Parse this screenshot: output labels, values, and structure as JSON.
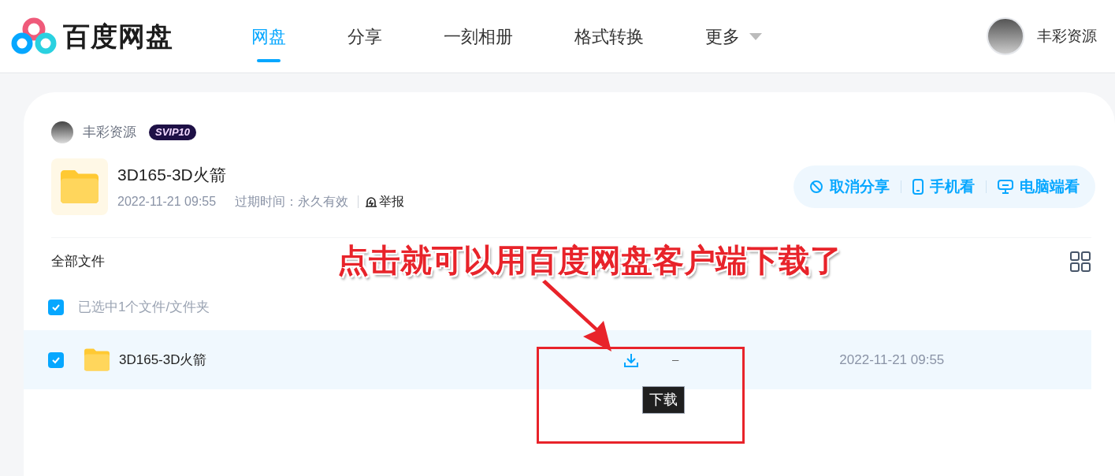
{
  "header": {
    "logo_text": "百度网盘",
    "nav": [
      {
        "label": "网盘",
        "selected": true,
        "dropdown": false
      },
      {
        "label": "分享",
        "selected": false,
        "dropdown": false
      },
      {
        "label": "一刻相册",
        "selected": false,
        "dropdown": false
      },
      {
        "label": "格式转换",
        "selected": false,
        "dropdown": false
      },
      {
        "label": "更多",
        "selected": false,
        "dropdown": true
      }
    ],
    "user": "丰彩资源"
  },
  "share": {
    "owner": "丰彩资源",
    "badge": "SVIP10",
    "title": "3D165-3D火箭",
    "date": "2022-11-21 09:55",
    "expiry": "过期时间：永久有效",
    "report": "举报",
    "actions": [
      {
        "kind": "cancel",
        "label": "取消分享"
      },
      {
        "kind": "phone",
        "label": "手机看"
      },
      {
        "kind": "desktop",
        "label": "电脑端看"
      }
    ]
  },
  "files": {
    "breadcrumb": "全部文件",
    "select_all": {
      "checked": true,
      "label": "已选中1个文件/文件夹"
    },
    "rows": [
      {
        "name": "3D165-3D火箭",
        "size": "–",
        "date": "2022-11-21 09:55",
        "checked": true,
        "selected": true
      }
    ],
    "tooltip": "下载"
  },
  "annotation": {
    "text": "点击就可以用百度网盘客户端下载了"
  }
}
